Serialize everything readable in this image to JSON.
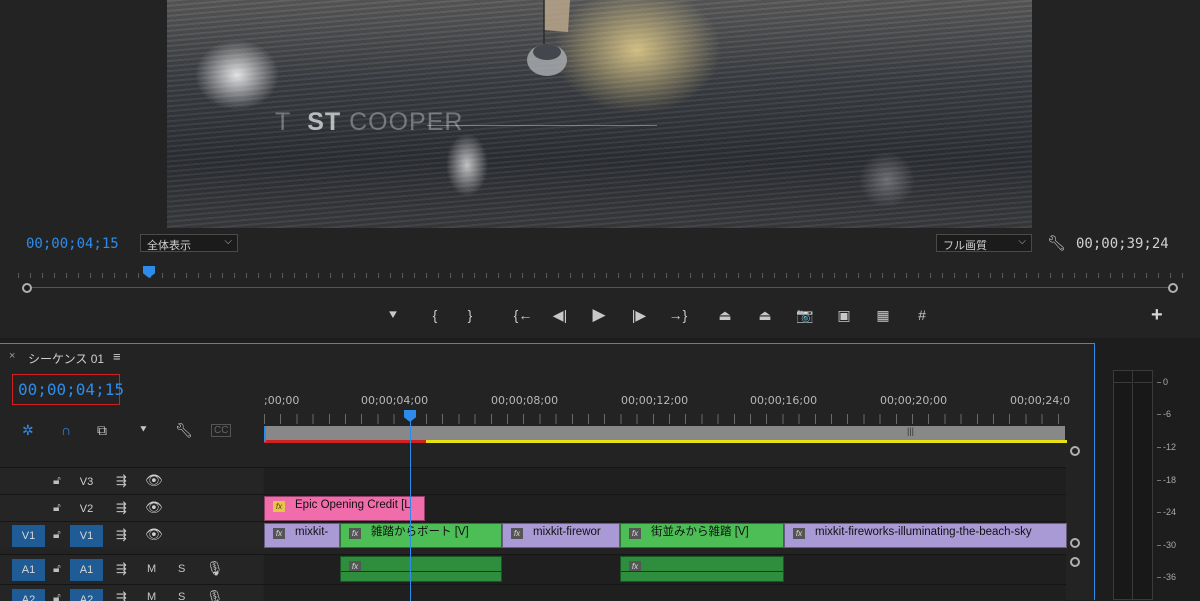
{
  "program_monitor": {
    "video_title_bold": "ST",
    "video_title_rest": " COOPER",
    "video_title_faded": "T",
    "timecode_current": "00;00;04;15",
    "timecode_duration": "00;00;39;24",
    "zoom_select": "全体表示",
    "quality_select": "フル画質",
    "transport_buttons": [
      "add-marker",
      "mark-in",
      "mark-out",
      "go-to-in",
      "step-back",
      "play",
      "step-forward",
      "go-to-out",
      "lift",
      "extract",
      "export-frame",
      "comparison-view",
      "toggle-multi-camera",
      "safe-margins"
    ],
    "transport_glyphs": {
      "add_marker": "⯆",
      "mark_in": "{",
      "mark_out": "}",
      "go_to_in": "{←",
      "step_back": "◀|",
      "play": "▶",
      "step_forward": "|▶",
      "go_to_out": "→}",
      "lift": "⏏",
      "extract": "⏏",
      "export_frame": "📷",
      "comparison": "▣",
      "multicam": "▦",
      "safe_margins": "#"
    },
    "add_button": "+"
  },
  "timeline": {
    "close_glyph": "×",
    "sequence_name": "シーケンス 01",
    "menu_glyph": "≡",
    "timecode": "00;00;04;15",
    "tool_icons": [
      "nest-icon",
      "snap-icon",
      "linked-selection-icon",
      "add-marker-icon",
      "settings-icon",
      "captions-icon"
    ],
    "captions_label": "CC",
    "ruler_times": [
      ";00;00",
      "00;00;04;00",
      "00;00;08;00",
      "00;00;12;00",
      "00;00;16;00",
      "00;00;20;00",
      "00;00;24;0"
    ],
    "tracks": {
      "v3": {
        "label": "V3"
      },
      "v2": {
        "label": "V2"
      },
      "v1": {
        "source": "V1",
        "label": "V1"
      },
      "a1": {
        "source": "A1",
        "label": "A1",
        "mute": "M",
        "solo": "S"
      },
      "a2": {
        "source": "A2",
        "label": "A2",
        "mute": "M",
        "solo": "S"
      }
    },
    "clips": {
      "v2_title": "Epic Opening Credit [L",
      "v1_1": "mixkit-",
      "v1_2": "雑踏からボート [V]",
      "v1_3": "mixkit-firewor",
      "v1_4": "街並みから雑踏 [V]",
      "v1_5": "mixkit-fireworks-illuminating-the-beach-sky"
    },
    "fx_badge": "fx"
  },
  "audio_meter": {
    "db_scale": [
      "0",
      "-6",
      "-12",
      "-18",
      "-24",
      "-30",
      "-36"
    ]
  },
  "colors": {
    "accent_blue": "#2d8ceb",
    "clip_purple": "#a99ad6",
    "clip_green": "#4dbd55",
    "clip_pink": "#f06caa",
    "render_yellow": "#e6e016",
    "timecode_border": "#d02020"
  }
}
